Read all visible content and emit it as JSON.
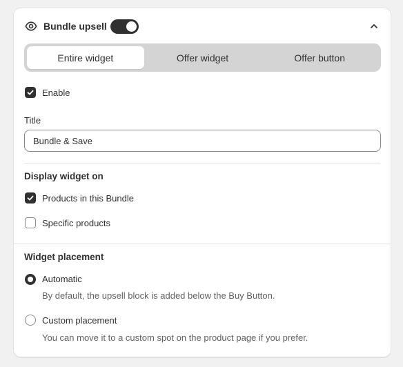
{
  "header": {
    "title": "Bundle upsell",
    "toggle_on": true
  },
  "tabs": [
    {
      "label": "Entire widget",
      "active": true
    },
    {
      "label": "Offer widget",
      "active": false
    },
    {
      "label": "Offer button",
      "active": false
    }
  ],
  "enable": {
    "label": "Enable",
    "checked": true
  },
  "title_field": {
    "label": "Title",
    "value": "Bundle & Save"
  },
  "display_section": {
    "title": "Display widget on",
    "options": [
      {
        "label": "Products in this Bundle",
        "checked": true
      },
      {
        "label": "Specific products",
        "checked": false
      }
    ]
  },
  "placement_section": {
    "title": "Widget placement",
    "options": [
      {
        "label": "Automatic",
        "help": "By default, the upsell block is added below the Buy Button.",
        "selected": true
      },
      {
        "label": "Custom placement",
        "help": "You can move it to a custom spot on the product page if you prefer.",
        "selected": false
      }
    ]
  },
  "colors": {
    "primary": "#303030",
    "border": "#8a8a8a",
    "muted_text": "#616161",
    "tabs_bg": "#d4d4d4"
  }
}
